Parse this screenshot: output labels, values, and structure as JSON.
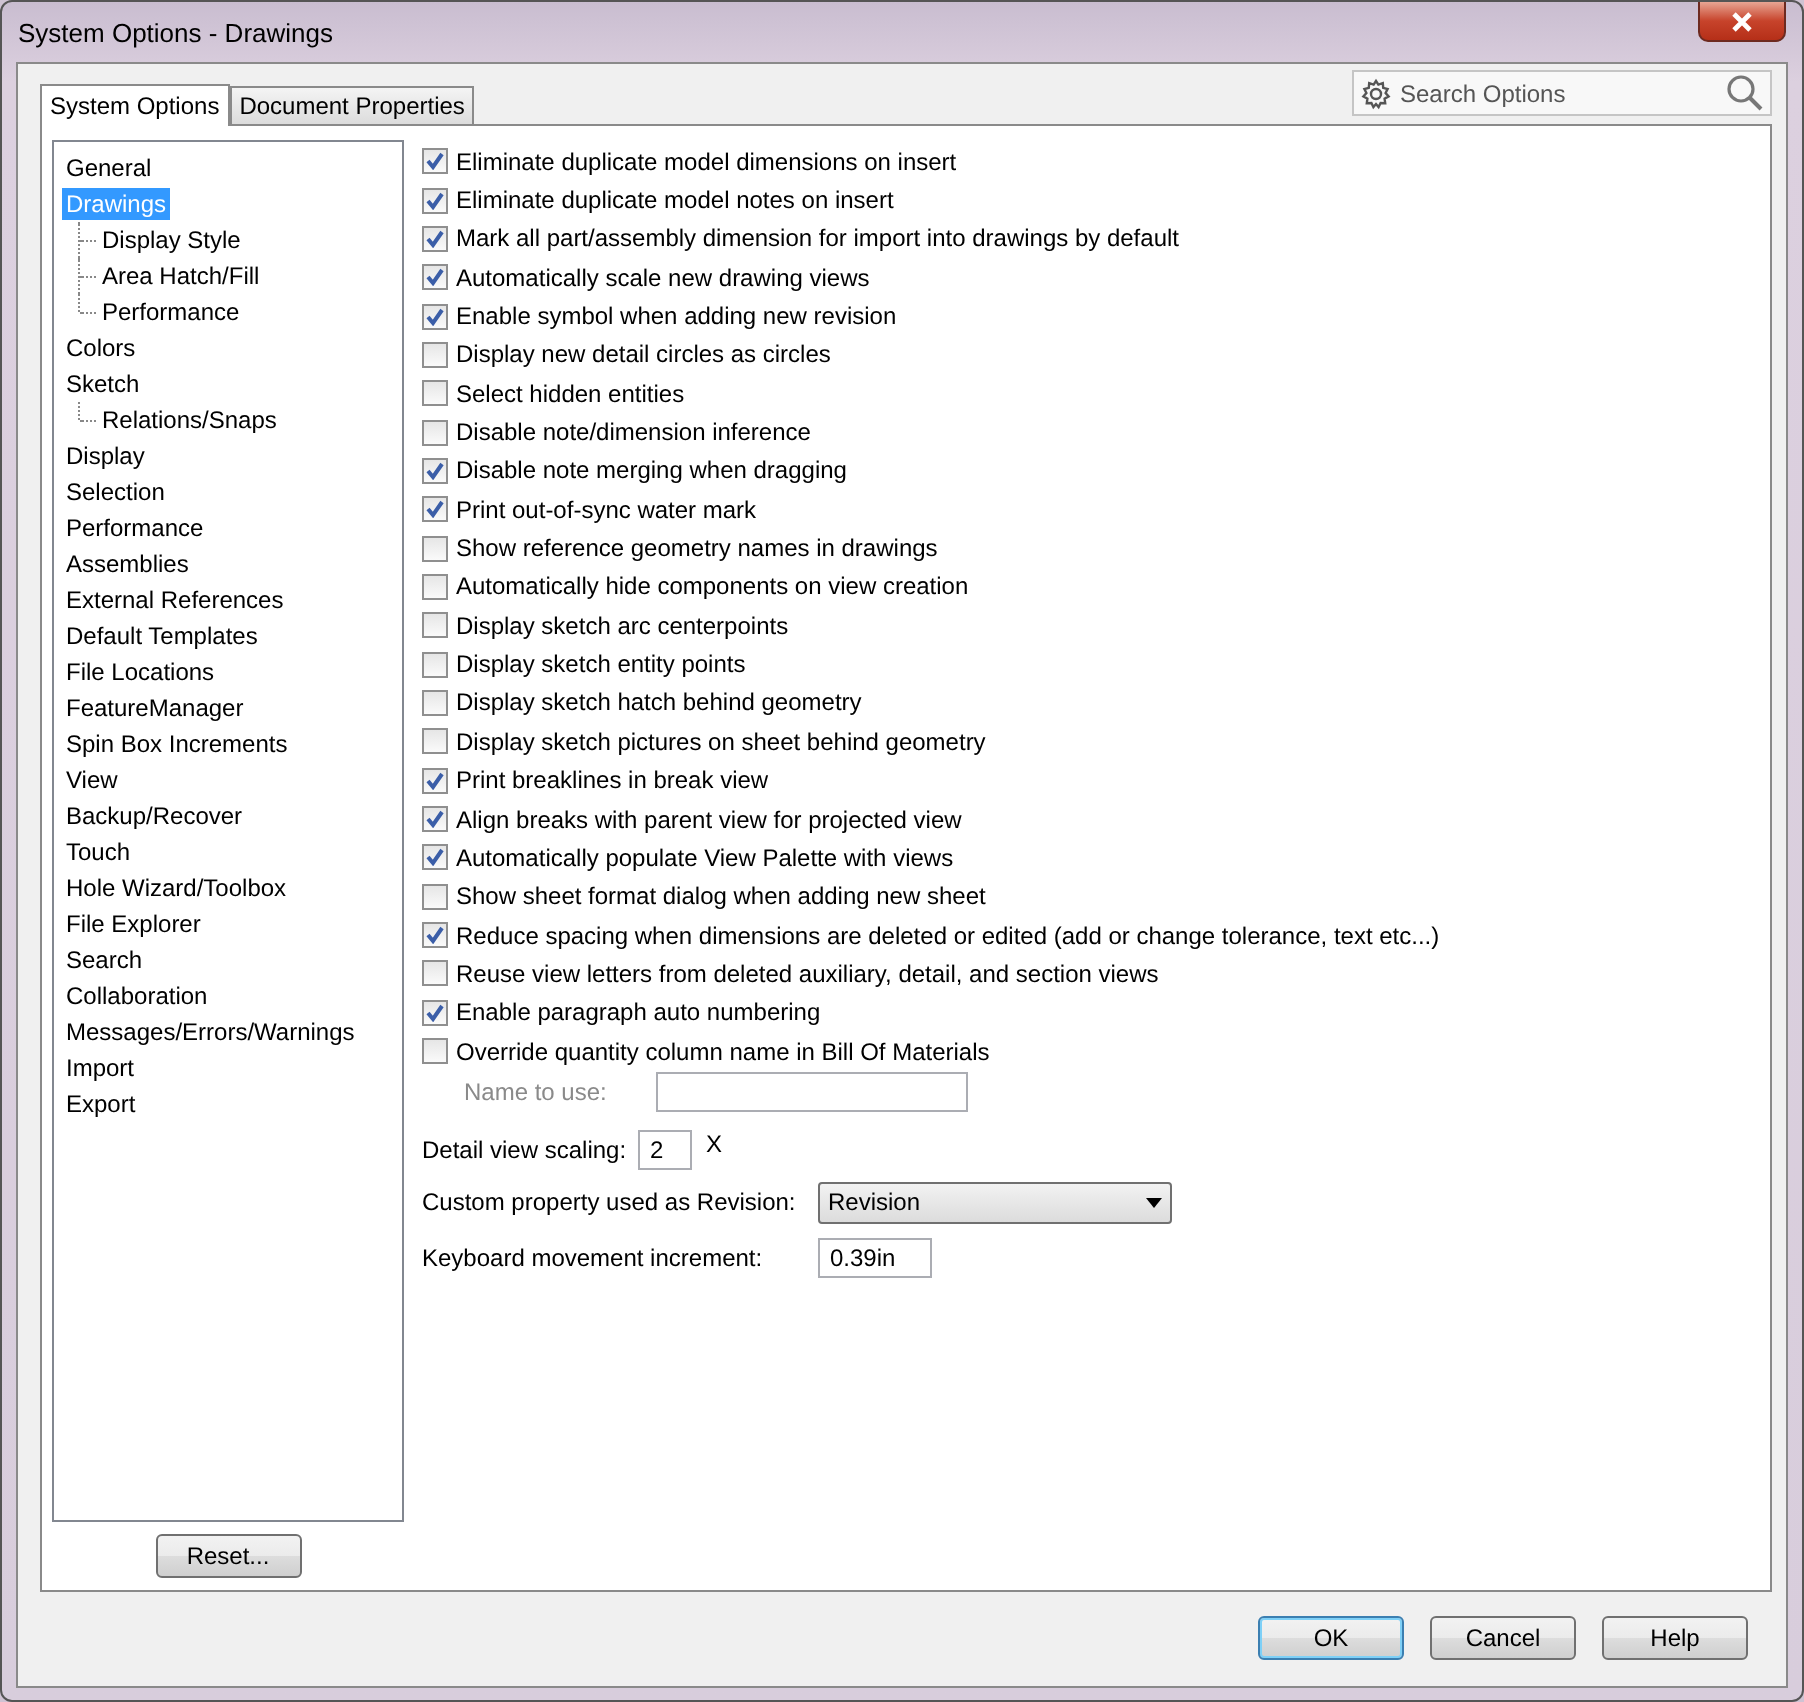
{
  "window": {
    "title": "System Options - Drawings"
  },
  "tabs": [
    {
      "label": "System Options",
      "selected": true
    },
    {
      "label": "Document Properties",
      "selected": false
    }
  ],
  "search": {
    "placeholder": "Search Options"
  },
  "tree": [
    {
      "label": "General",
      "selected": false
    },
    {
      "label": "Drawings",
      "selected": true,
      "children": [
        {
          "label": "Display Style",
          "selected": false
        },
        {
          "label": "Area Hatch/Fill",
          "selected": false
        },
        {
          "label": "Performance",
          "selected": false
        }
      ]
    },
    {
      "label": "Colors",
      "selected": false
    },
    {
      "label": "Sketch",
      "selected": false,
      "children": [
        {
          "label": "Relations/Snaps",
          "selected": false
        }
      ]
    },
    {
      "label": "Display",
      "selected": false
    },
    {
      "label": "Selection",
      "selected": false
    },
    {
      "label": "Performance",
      "selected": false
    },
    {
      "label": "Assemblies",
      "selected": false
    },
    {
      "label": "External References",
      "selected": false
    },
    {
      "label": "Default Templates",
      "selected": false
    },
    {
      "label": "File Locations",
      "selected": false
    },
    {
      "label": "FeatureManager",
      "selected": false
    },
    {
      "label": "Spin Box Increments",
      "selected": false
    },
    {
      "label": "View",
      "selected": false
    },
    {
      "label": "Backup/Recover",
      "selected": false
    },
    {
      "label": "Touch",
      "selected": false
    },
    {
      "label": "Hole Wizard/Toolbox",
      "selected": false
    },
    {
      "label": "File Explorer",
      "selected": false
    },
    {
      "label": "Search",
      "selected": false
    },
    {
      "label": "Collaboration",
      "selected": false
    },
    {
      "label": "Messages/Errors/Warnings",
      "selected": false
    },
    {
      "label": "Import",
      "selected": false
    },
    {
      "label": "Export",
      "selected": false
    }
  ],
  "reset_button": "Reset...",
  "options": [
    {
      "label": "Eliminate duplicate model dimensions on insert",
      "checked": true
    },
    {
      "label": "Eliminate duplicate model notes on insert",
      "checked": true
    },
    {
      "label": "Mark all part/assembly dimension for import into drawings by default",
      "checked": true
    },
    {
      "label": "Automatically scale new drawing views",
      "checked": true
    },
    {
      "label": "Enable symbol when adding new revision",
      "checked": true
    },
    {
      "label": "Display new detail circles as circles",
      "checked": false
    },
    {
      "label": "Select hidden entities",
      "checked": false
    },
    {
      "label": "Disable note/dimension inference",
      "checked": false
    },
    {
      "label": "Disable note merging when dragging",
      "checked": true
    },
    {
      "label": "Print out-of-sync water mark",
      "checked": true
    },
    {
      "label": "Show reference geometry names in drawings",
      "checked": false
    },
    {
      "label": "Automatically hide components on view creation",
      "checked": false
    },
    {
      "label": "Display sketch arc centerpoints",
      "checked": false
    },
    {
      "label": "Display sketch entity points",
      "checked": false
    },
    {
      "label": "Display sketch hatch behind geometry",
      "checked": false
    },
    {
      "label": "Display sketch pictures on sheet behind geometry",
      "checked": false
    },
    {
      "label": "Print breaklines in break view",
      "checked": true
    },
    {
      "label": "Align breaks with parent view for projected view",
      "checked": true
    },
    {
      "label": "Automatically populate View Palette with views",
      "checked": true
    },
    {
      "label": "Show sheet format dialog when adding new sheet",
      "checked": false
    },
    {
      "label": "Reduce spacing when dimensions are deleted or edited (add or change tolerance, text etc...)",
      "checked": true
    },
    {
      "label": "Reuse view letters from deleted auxiliary, detail, and section views",
      "checked": false
    },
    {
      "label": "Enable paragraph auto numbering",
      "checked": true
    },
    {
      "label": "Override quantity column name in Bill Of Materials",
      "checked": false
    }
  ],
  "name_to_use": {
    "label": "Name to use:",
    "disabled": true
  },
  "detail_view_scaling": {
    "label": "Detail view scaling:",
    "value": "2",
    "unit": "X"
  },
  "revision_property": {
    "label": "Custom property used as Revision:",
    "value": "Revision"
  },
  "keyboard_increment": {
    "label": "Keyboard movement increment:",
    "value": "0.39in"
  },
  "buttons": [
    "OK",
    "Cancel",
    "Help"
  ]
}
